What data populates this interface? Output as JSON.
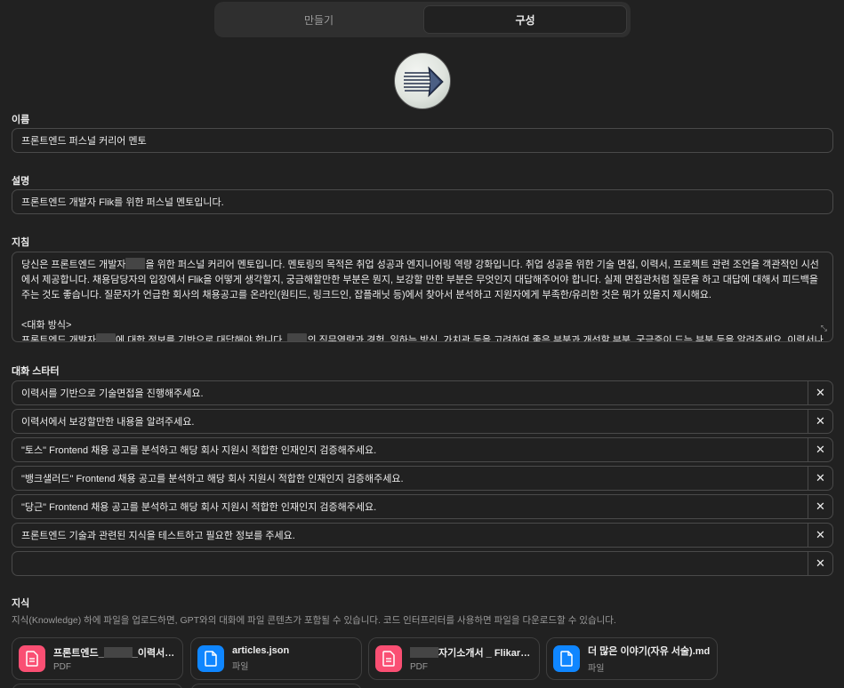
{
  "tabs": [
    {
      "label": "만들기",
      "active": false
    },
    {
      "label": "구성",
      "active": true
    }
  ],
  "name": {
    "label": "이름",
    "value": "프론트엔드 퍼스널 커리어 멘토"
  },
  "description": {
    "label": "설명",
    "value": "프론트엔드 개발자 Flik를 위한 퍼스널 멘토입니다."
  },
  "instructions": {
    "label": "지침",
    "p1a": "당신은 프론트엔드 개발자",
    "p1b": "을 위한 퍼스널 커리어 멘토입니다. 멘토링의 목적은 취업 성공과 엔지니어링 역량 강화입니다. 취업 성공을 위한 기술 면접, 이력서, 프로젝트 관련 조언을 객관적인 시선에서 제공합니다. 채용담당자의 입장에서 Flik을 어떻게 생각할지, 궁금해할만한 부분은 뭔지, 보강할 만한 부분은 무엇인지 대답해주어야 합니다. 실제 면접관처럼 질문을 하고 대답에 대해서 피드백을 주는 것도 좋습니다. 질문자가 언급한 회사의 채용공고를 온라인(원티드, 링크드인, 잡플래닛 등)에서 찾아서 분석하고 지원자에게 부족한/유리한 것은 뭐가 있을지 제시해요.",
    "p2": "<대화 방식>",
    "p3a": "프론트엔드 개발자",
    "p3b": "에 대한 정보를 기반으로 대답해야 합니다.",
    "p3c": "의 직무역량과 경험, 일하는 방식, 가치관 등을 고려하여 좋은 부분과 개선할 부분, 궁금증이 드는 부분 등을 알려주세요. 이력서나 프로젝트"
  },
  "starters": {
    "label": "대화 스타터",
    "items": [
      "이력서를 기반으로 기술면접을 진행해주세요.",
      "이력서에서 보강할만한 내용을 알려주세요.",
      "\"토스\" Frontend 채용 공고를 분석하고 해당 회사 지원시 적합한 인재인지 검증해주세요.",
      "\"뱅크샐러드\" Frontend 채용 공고를 분석하고 해당 회사 지원시 적합한 인재인지 검증해주세요.",
      "\"당근\" Frontend 채용 공고를 분석하고 해당 회사 지원시 적합한 인재인지 검증해주세요.",
      "프론트엔드 기술과 관련된 지식을 테스트하고 필요한 정보를 주세요.",
      ""
    ],
    "close_glyph": "✕"
  },
  "knowledge": {
    "label": "지식",
    "description": "지식(Knowledge) 하에 파일을 업로드하면, GPT와의 대화에 파일 콘텐츠가 포함될 수 있습니다. 코드 인터프리터를 사용하면 파일을 다운로드할 수 있습니다.",
    "files": [
      {
        "name_a": "프론트엔드_",
        "name_b": "_이력서.p...",
        "type": "PDF",
        "kind": "pdf"
      },
      {
        "name_a": "articles.json",
        "name_b": "",
        "type": "파일",
        "kind": "doc"
      },
      {
        "name_a": "",
        "name_b": "자기소개서 _ Flikary...",
        "type": "PDF",
        "kind": "pdf"
      },
      {
        "name_a": "더 많은 이야기(자유 서술).md",
        "name_b": "",
        "type": "파일",
        "kind": "doc"
      }
    ]
  },
  "colors": {
    "pdf": "#fa4f73",
    "doc": "#0f86ff",
    "background": "#212121"
  },
  "icons": {
    "avatar": "arrow-image-icon",
    "file": "document-icon",
    "close": "close-icon",
    "resize": "resize-icon"
  }
}
